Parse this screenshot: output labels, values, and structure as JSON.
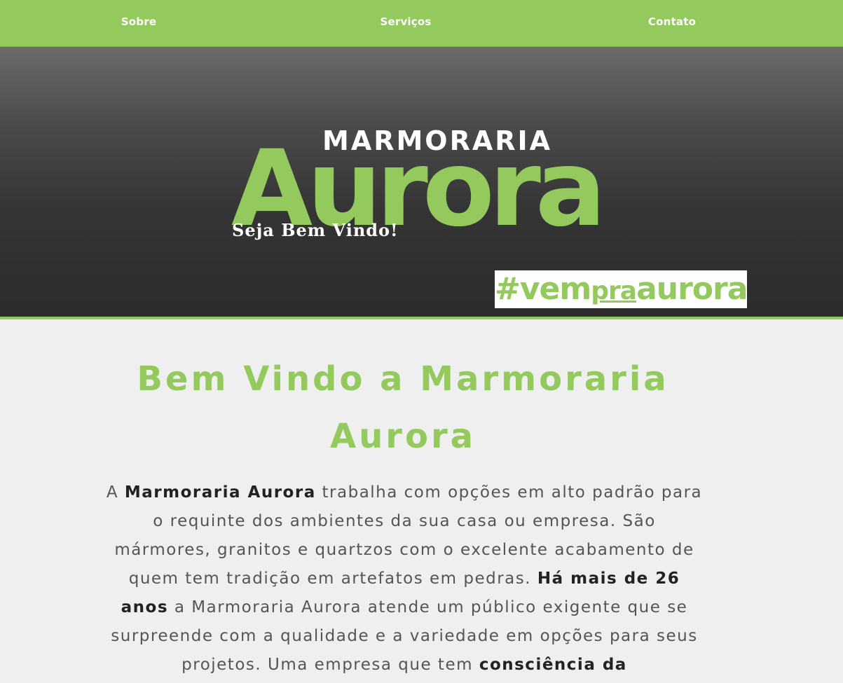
{
  "nav": {
    "items": [
      "Sobre",
      "Serviços",
      "Contato"
    ]
  },
  "hero": {
    "logo_top": "MARMORARIA",
    "logo_main": "Aurora",
    "welcome": "Seja Bem Vindo!",
    "hashtag_pre": "#vem",
    "hashtag_mid": "pra",
    "hashtag_post": "aurora"
  },
  "main": {
    "heading": "Bem Vindo a Marmoraria Aurora",
    "para": {
      "p1": "A ",
      "b1": "Marmoraria Aurora",
      "p2": " trabalha com opções em alto padrão para o requinte dos ambientes da sua casa ou empresa. São mármores, granitos e quartzos com o excelente acabamento de quem tem tradição em artefatos em pedras. ",
      "b2": "Há mais de 26 anos",
      "p3": " a Marmoraria Aurora atende um público exigente que se surpreende com a qualidade e a variedade em opções para seus projetos. Uma empresa que tem ",
      "b3": "consciência da"
    }
  },
  "colors": {
    "accent": "#93c95d",
    "hero_dark": "#2c2c2c",
    "background": "#efefef"
  }
}
